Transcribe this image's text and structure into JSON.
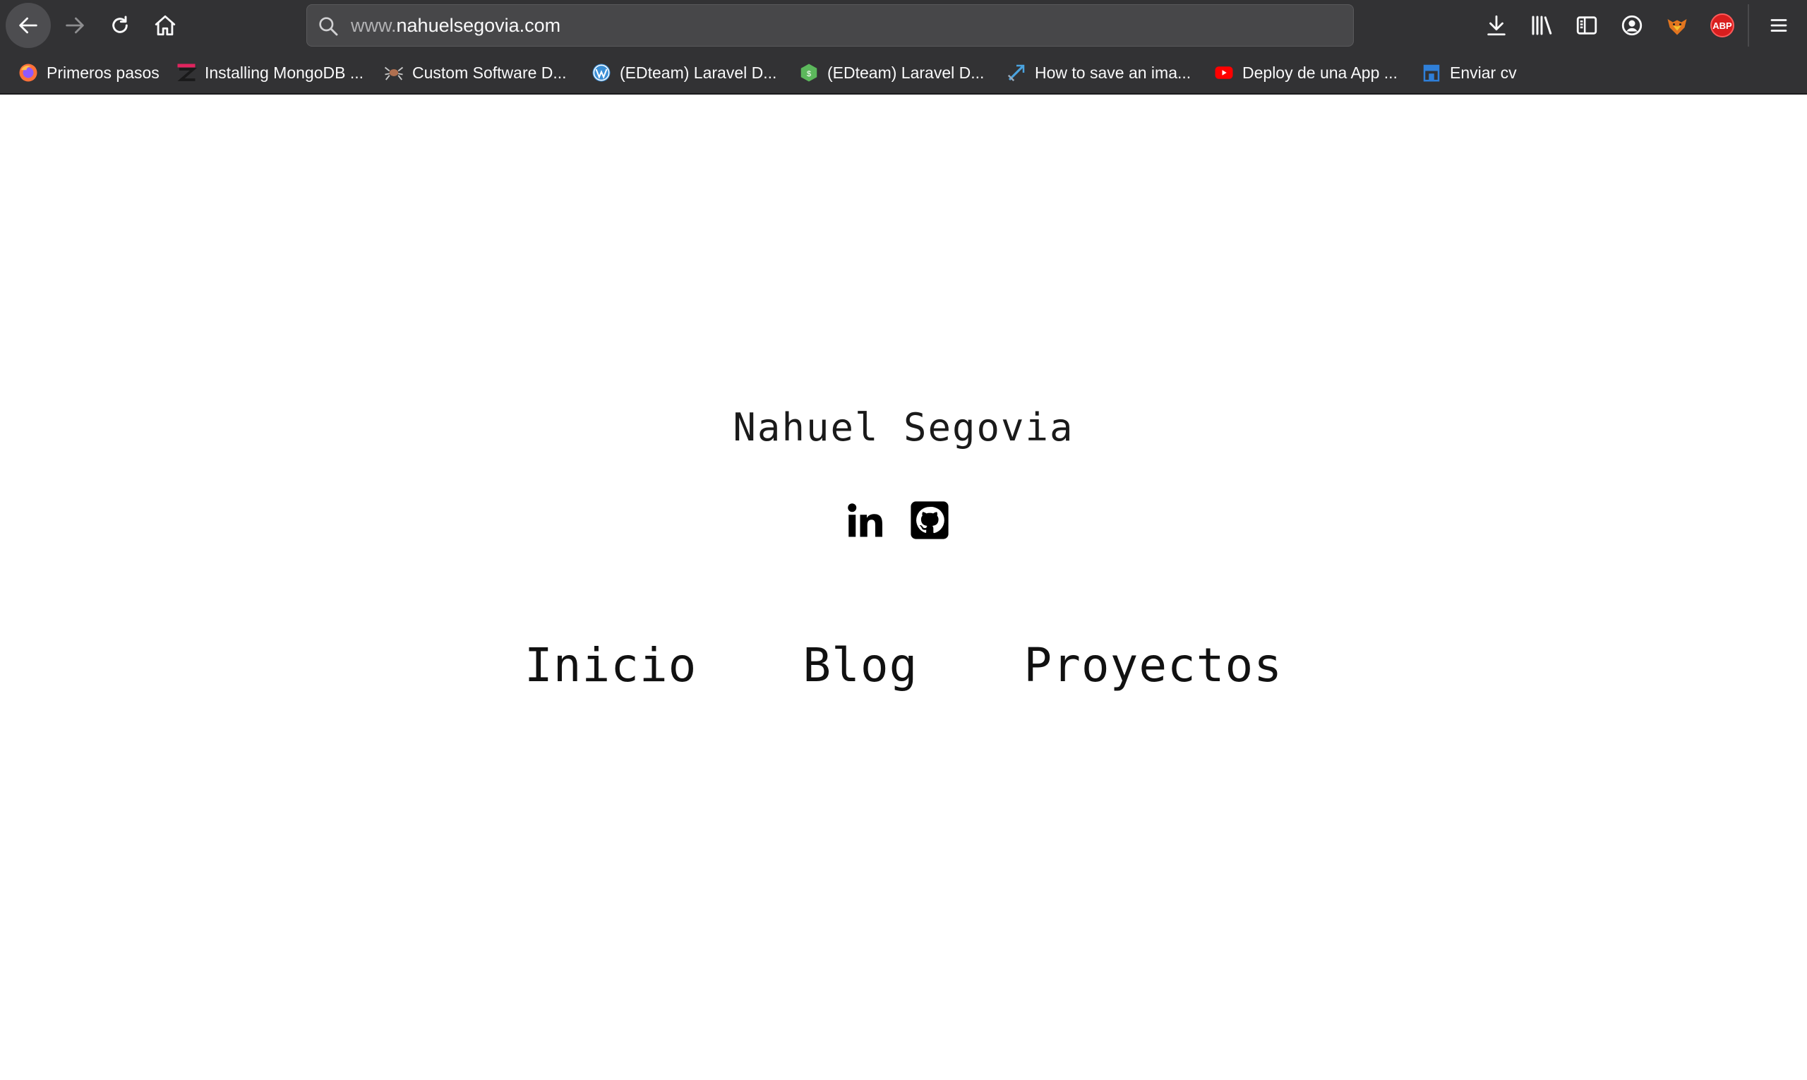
{
  "browser": {
    "url_prefix": "www.",
    "url_domain": "nahuelsegovia.com",
    "extensions": {
      "abp_label": "ABP"
    },
    "icons": [
      "back-arrow-icon",
      "forward-arrow-icon",
      "reload-icon",
      "home-icon",
      "search-icon",
      "downloads-icon",
      "library-icon",
      "sidebar-icon",
      "account-icon",
      "fox-extension-icon",
      "adblock-icon",
      "hamburger-menu-icon"
    ]
  },
  "bookmarks": [
    {
      "label": "Primeros pasos",
      "icon": "firefox-icon",
      "color": "#ff7139"
    },
    {
      "label": "Installing MongoDB ...",
      "icon": "z-logo-icon",
      "color": "#e0245e"
    },
    {
      "label": "Custom Software D...",
      "icon": "spider-icon",
      "color": "#b07050"
    },
    {
      "label": "(EDteam) Laravel D...",
      "icon": "wordpress-icon",
      "color": "#3b8fd6"
    },
    {
      "label": "(EDteam) Laravel D...",
      "icon": "hexagon-icon",
      "color": "#5cb85c"
    },
    {
      "label": "How to save an ima...",
      "icon": "arrow-tool-icon",
      "color": "#4aa3df"
    },
    {
      "label": "Deploy de una App ...",
      "icon": "youtube-icon",
      "color": "#ff0000"
    },
    {
      "label": "Enviar cv",
      "icon": "storefront-icon",
      "color": "#2f7fd8"
    }
  ],
  "site": {
    "name": "Nahuel Segovia",
    "social": [
      "linkedin-icon",
      "github-icon"
    ],
    "nav": [
      "Inicio",
      "Blog",
      "Proyectos"
    ]
  }
}
